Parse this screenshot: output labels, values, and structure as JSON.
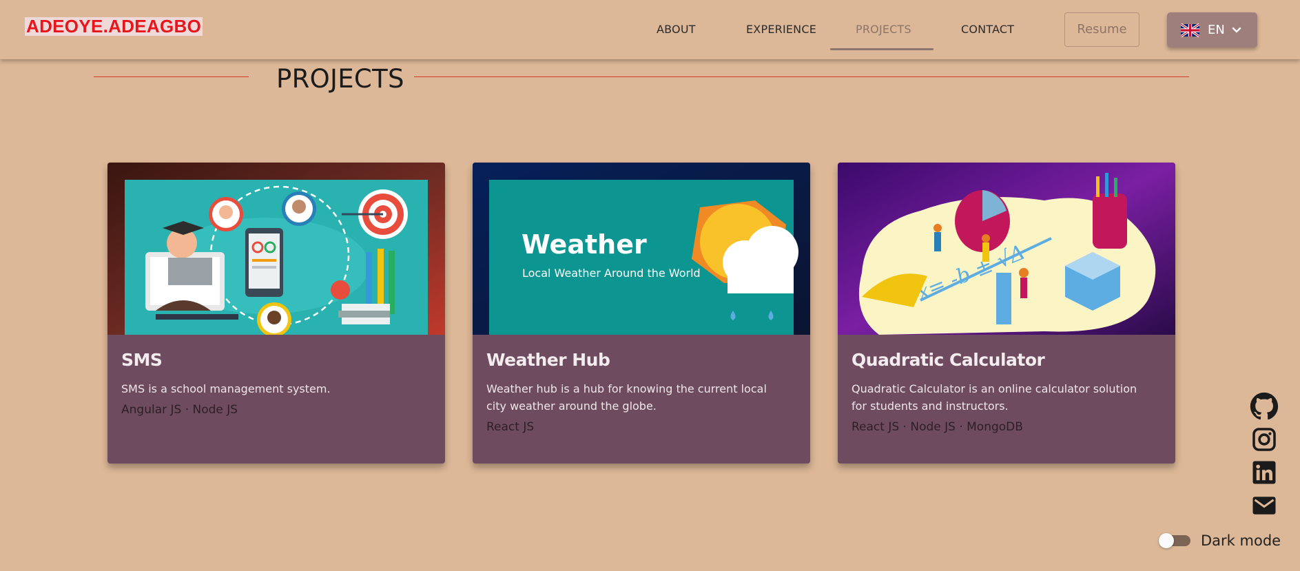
{
  "header": {
    "logo": "ADEOYE.ADEAGBO",
    "nav": [
      {
        "label": "ABOUT",
        "active": false
      },
      {
        "label": "EXPERIENCE",
        "active": false
      },
      {
        "label": "PROJECTS",
        "active": true
      },
      {
        "label": "CONTACT",
        "active": false
      }
    ],
    "resume_label": "Resume",
    "language": {
      "code": "EN",
      "flag": "uk-flag-icon"
    }
  },
  "section": {
    "title": "PROJECTS"
  },
  "projects": [
    {
      "title": "SMS",
      "description": "SMS is a school management system.",
      "tech": "Angular JS · Node JS",
      "image": "school-management-illustration"
    },
    {
      "title": "Weather Hub",
      "description": "Weather hub is a hub for knowing the current local city weather around the globe.",
      "tech": "React JS",
      "image": "weather-banner",
      "image_title": "Weather",
      "image_subtitle": "Local Weather Around the World"
    },
    {
      "title": "Quadratic Calculator",
      "description": "Quadratic Calculator is an online calculator solution for students and instructors.",
      "tech": "React JS · Node JS · MongoDB",
      "image": "math-isometric-illustration"
    }
  ],
  "social": [
    "github-icon",
    "instagram-icon",
    "linkedin-icon",
    "mail-icon"
  ],
  "dark_mode": {
    "label": "Dark mode",
    "enabled": false
  },
  "colors": {
    "background": "#ddb898",
    "card": "#6e4b5e",
    "logo_red": "#e8151d",
    "rule_red": "#d63a2c",
    "lang_button": "#9e7f7c"
  }
}
